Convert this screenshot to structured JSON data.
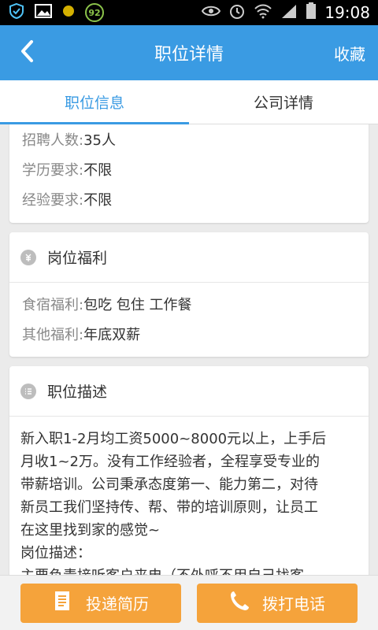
{
  "status_bar": {
    "time": "19:08",
    "battery_badge": "92"
  },
  "app_bar": {
    "back_icon": "chevron-left-icon",
    "title": "职位详情",
    "favorite_label": "收藏"
  },
  "tabs": [
    {
      "label": "职位信息",
      "active": true
    },
    {
      "label": "公司详情",
      "active": false
    }
  ],
  "job_info": {
    "rows": [
      {
        "label": "招聘人数:",
        "value": "35人"
      },
      {
        "label": "学历要求:",
        "value": "不限"
      },
      {
        "label": "经验要求:",
        "value": "不限"
      }
    ]
  },
  "benefits": {
    "icon": "coin-icon",
    "title": "岗位福利",
    "rows": [
      {
        "label": "食宿福利:",
        "value": "包吃 包住 工作餐"
      },
      {
        "label": "其他福利:",
        "value": "年底双薪"
      }
    ]
  },
  "description": {
    "icon": "list-icon",
    "title": "职位描述",
    "lines": [
      "新入职1-2月均工资5000~8000元以上，上手后",
      "月收1~2万。没有工作经验者，全程享受专业的",
      "带薪培训。公司秉承态度第一、能力第二，对待",
      "新员工我们坚持传、帮、带的培训原则，让员工",
      "在这里找到家的感觉~",
      "岗位描述：",
      "主要负责接听客户来电（不外呼不用自己找客"
    ]
  },
  "actions": {
    "submit_resume": {
      "label": "投递简历",
      "icon": "document-icon"
    },
    "call": {
      "label": "拨打电话",
      "icon": "phone-icon"
    }
  },
  "colors": {
    "primary": "#3a9be3",
    "action": "#f5a33b"
  }
}
